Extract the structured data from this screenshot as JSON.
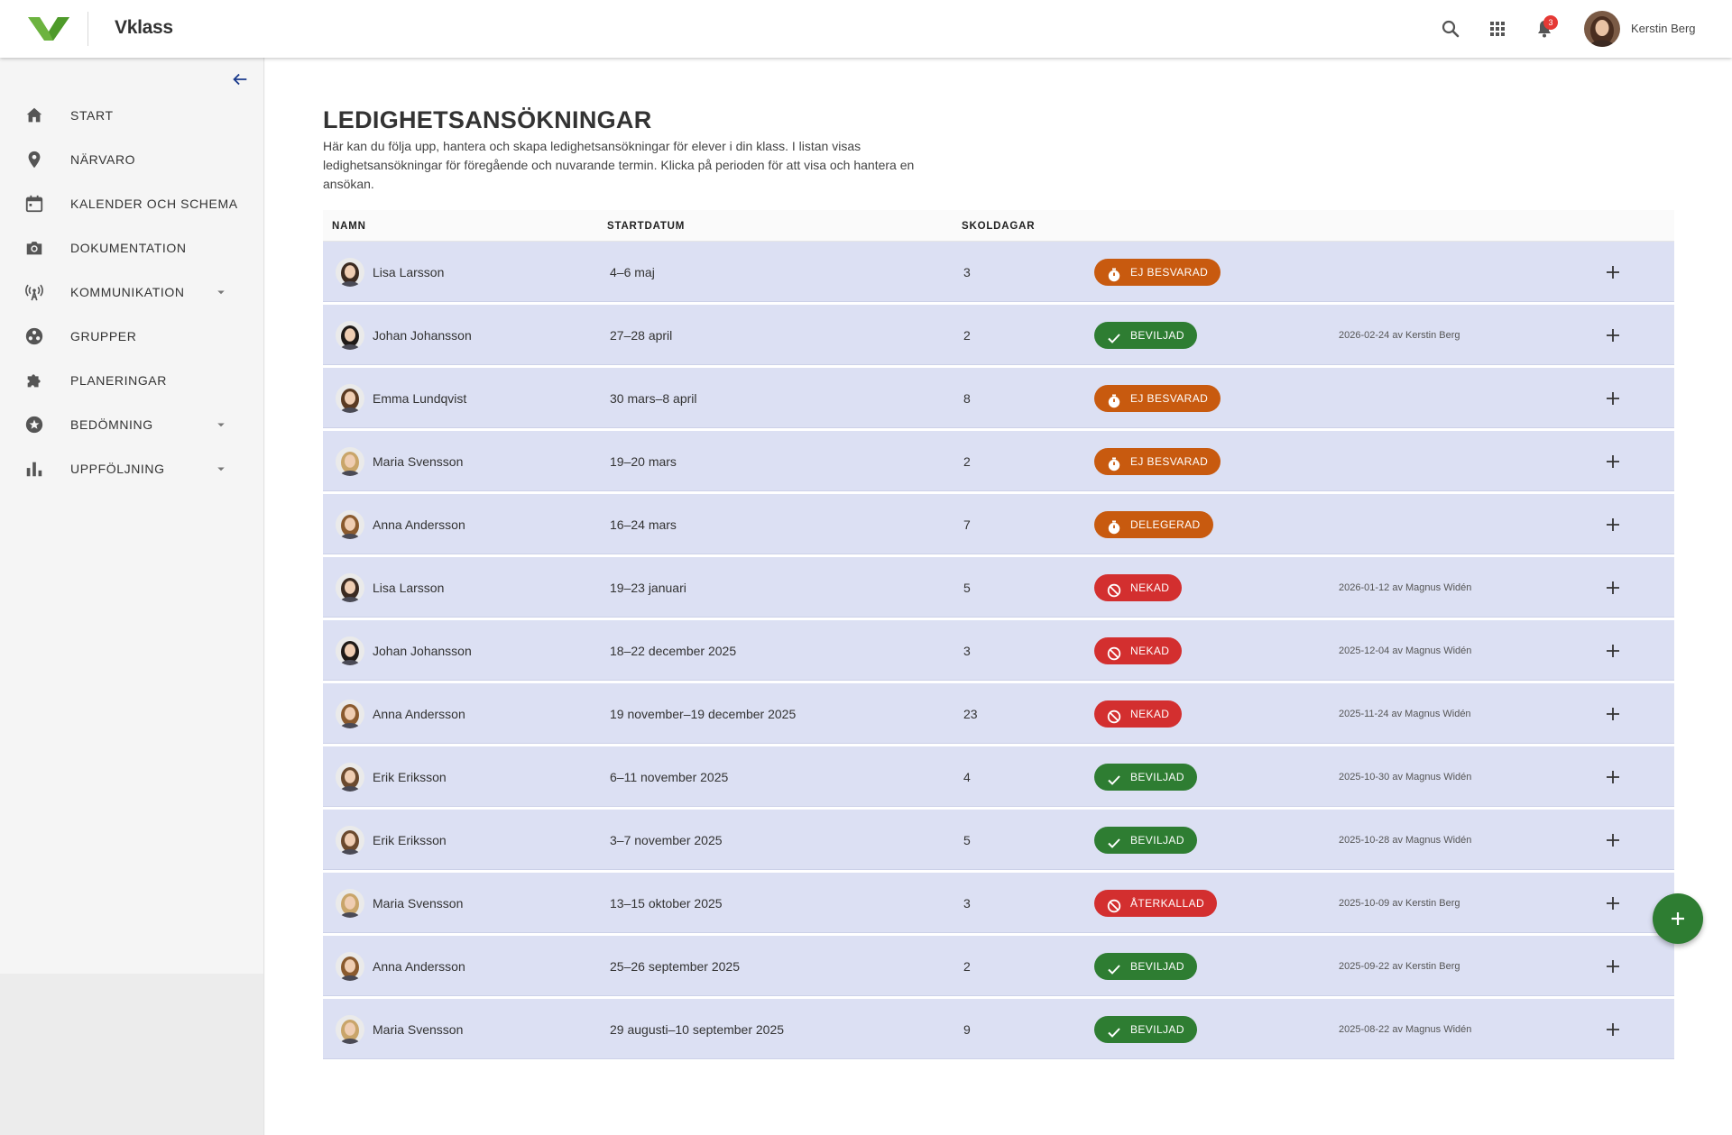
{
  "header": {
    "brand": "Vklass",
    "user_name": "Kerstin Berg",
    "notifications_count": "3",
    "icons": [
      "search-icon",
      "apps-grid-icon",
      "bell-icon"
    ]
  },
  "sidebar": {
    "items": [
      {
        "label": "START",
        "icon": "home-icon",
        "has_submenu": false
      },
      {
        "label": "NÄRVARO",
        "icon": "location-pin-icon",
        "has_submenu": false
      },
      {
        "label": "KALENDER OCH SCHEMA",
        "icon": "calendar-icon",
        "has_submenu": false
      },
      {
        "label": "DOKUMENTATION",
        "icon": "camera-icon",
        "has_submenu": false
      },
      {
        "label": "KOMMUNIKATION",
        "icon": "broadcast-icon",
        "has_submenu": true
      },
      {
        "label": "GRUPPER",
        "icon": "group-icon",
        "has_submenu": false
      },
      {
        "label": "PLANERINGAR",
        "icon": "puzzle-icon",
        "has_submenu": false
      },
      {
        "label": "BEDÖMNING",
        "icon": "star-icon",
        "has_submenu": true
      },
      {
        "label": "UPPFÖLJNING",
        "icon": "bar-chart-icon",
        "has_submenu": true
      }
    ]
  },
  "main": {
    "title": "LEDIGHETSANSÖKNINGAR",
    "description": "Här kan du följa upp, hantera och skapa ledighetsansökningar för elever i din klass. I listan visas ledighetsansökningar för föregående och nuvarande termin. Klicka på perioden för att visa och hantera en ansökan.",
    "columns": {
      "name": "NAMN",
      "start": "STARTDATUM",
      "days": "SKOLDAGAR"
    }
  },
  "colors": {
    "ej_besvarad": "#c85a0f",
    "beviljad": "#2e7d32",
    "nekad": "#d32f2f",
    "row_bg": "#dce0f3"
  },
  "rows": [
    {
      "name": "Lisa Larsson",
      "period": "4–6 maj",
      "days": "3",
      "status": "EJ BESVARAD",
      "status_type": "pending",
      "meta": ""
    },
    {
      "name": "Johan Johansson",
      "period": "27–28 april",
      "days": "2",
      "status": "BEVILJAD",
      "status_type": "approved",
      "meta": "2026-02-24 av Kerstin Berg"
    },
    {
      "name": "Emma Lundqvist",
      "period": "30 mars–8 april",
      "days": "8",
      "status": "EJ BESVARAD",
      "status_type": "pending",
      "meta": ""
    },
    {
      "name": "Maria Svensson",
      "period": "19–20 mars",
      "days": "2",
      "status": "EJ BESVARAD",
      "status_type": "pending",
      "meta": ""
    },
    {
      "name": "Anna Andersson",
      "period": "16–24 mars",
      "days": "7",
      "status": "DELEGERAD",
      "status_type": "pending",
      "meta": ""
    },
    {
      "name": "Lisa Larsson",
      "period": "19–23 januari",
      "days": "5",
      "status": "NEKAD",
      "status_type": "denied",
      "meta": "2026-01-12 av Magnus Widén"
    },
    {
      "name": "Johan Johansson",
      "period": "18–22 december 2025",
      "days": "3",
      "status": "NEKAD",
      "status_type": "denied",
      "meta": "2025-12-04 av Magnus Widén"
    },
    {
      "name": "Anna Andersson",
      "period": "19 november–19 december 2025",
      "days": "23",
      "status": "NEKAD",
      "status_type": "denied",
      "meta": "2025-11-24 av Magnus Widén"
    },
    {
      "name": "Erik Eriksson",
      "period": "6–11 november 2025",
      "days": "4",
      "status": "BEVILJAD",
      "status_type": "approved",
      "meta": "2025-10-30 av Magnus Widén"
    },
    {
      "name": "Erik Eriksson",
      "period": "3–7 november 2025",
      "days": "5",
      "status": "BEVILJAD",
      "status_type": "approved",
      "meta": "2025-10-28 av Magnus Widén"
    },
    {
      "name": "Maria Svensson",
      "period": "13–15 oktober 2025",
      "days": "3",
      "status": "ÅTERKALLAD",
      "status_type": "denied",
      "meta": "2025-10-09 av Kerstin Berg"
    },
    {
      "name": "Anna Andersson",
      "period": "25–26 september 2025",
      "days": "2",
      "status": "BEVILJAD",
      "status_type": "approved",
      "meta": "2025-09-22 av Kerstin Berg"
    },
    {
      "name": "Maria Svensson",
      "period": "29 augusti–10 september 2025",
      "days": "9",
      "status": "BEVILJAD",
      "status_type": "approved",
      "meta": "2025-08-22 av Magnus Widén"
    }
  ]
}
